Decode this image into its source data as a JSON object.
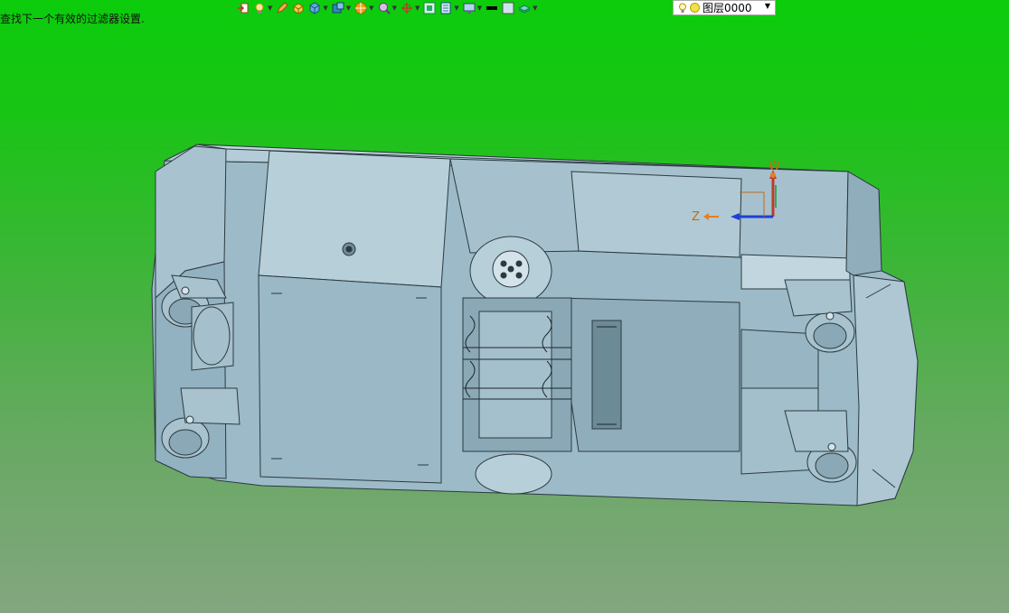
{
  "status_message": "查找下一个有效的过滤器设置.",
  "toolbar": {
    "tools": [
      {
        "icon": "import-icon",
        "color": "#c0392b",
        "dropdown": false
      },
      {
        "icon": "lightbulb-icon",
        "color": "#f1c40f",
        "dropdown": true
      },
      {
        "icon": "pencil-icon",
        "color": "#e67e22",
        "dropdown": false
      },
      {
        "icon": "box-yellow-icon",
        "color": "#f4d03f",
        "dropdown": false
      },
      {
        "icon": "cube-blue-icon",
        "color": "#2e86c1",
        "dropdown": true
      },
      {
        "icon": "cube-stack-icon",
        "color": "#1f618d",
        "dropdown": true
      },
      {
        "icon": "sphere-render-icon",
        "color": "#e67e22",
        "dropdown": true
      },
      {
        "icon": "zoom-icon",
        "color": "#a569bd",
        "dropdown": true
      },
      {
        "icon": "rotate-axis-icon",
        "color": "#c0392b",
        "dropdown": true
      },
      {
        "icon": "fit-view-icon",
        "color": "#27ae60",
        "dropdown": false
      },
      {
        "icon": "panel-icon",
        "color": "#2874a6",
        "dropdown": true
      },
      {
        "icon": "display-settings-icon",
        "color": "#5d6d7e",
        "dropdown": true
      },
      {
        "icon": "line-color-icon",
        "color": "#000000",
        "dropdown": false
      },
      {
        "icon": "fill-color-icon",
        "color": "#cfe3ee",
        "dropdown": false
      },
      {
        "icon": "layer-stack-icon",
        "color": "#48c9b0",
        "dropdown": true
      }
    ],
    "layer_label": "图层0000"
  },
  "viewport": {
    "model_color": "#9bb9c7",
    "axis_labels": {
      "y": "W",
      "z": "Z"
    }
  }
}
